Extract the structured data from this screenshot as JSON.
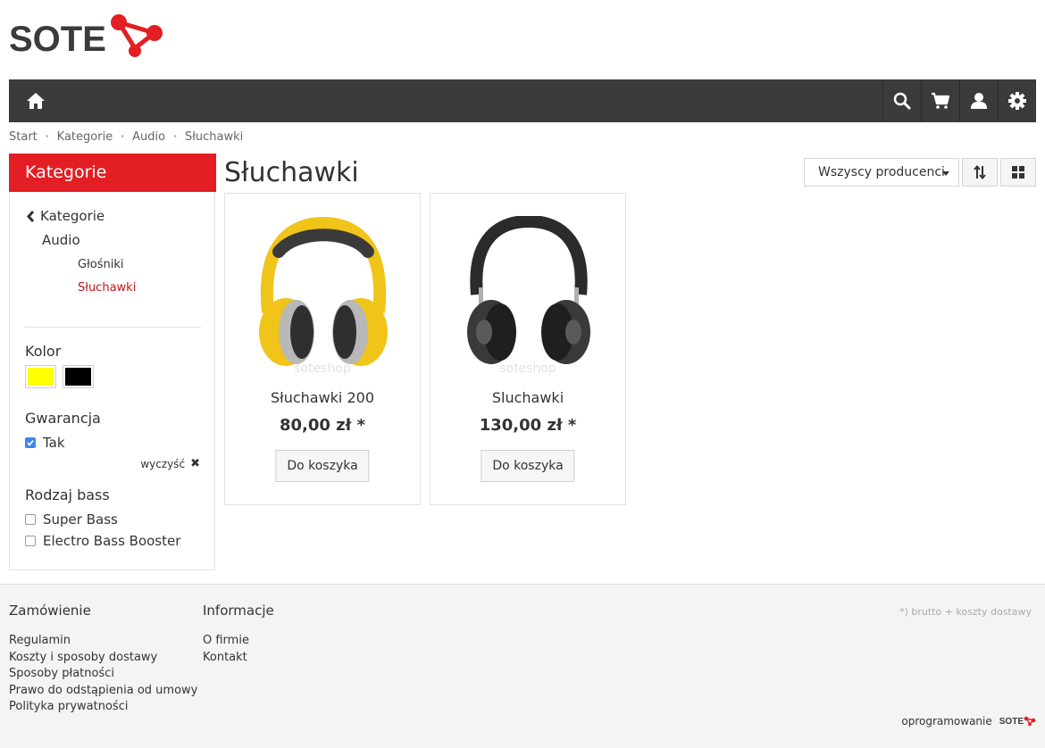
{
  "brand": {
    "logo_text": "SOTE",
    "accent": "#e31e24",
    "dark": "#3b3b3b"
  },
  "nav": {
    "home_icon": "home-icon",
    "right_icons": [
      "search-icon",
      "cart-icon",
      "user-icon",
      "gear-icon"
    ]
  },
  "breadcrumb": [
    "Start",
    "Kategorie",
    "Audio",
    "Słuchawki"
  ],
  "sidebar": {
    "heading": "Kategorie",
    "back_label": "Kategorie",
    "parent_label": "Audio",
    "children": [
      {
        "label": "Głośniki",
        "active": false
      },
      {
        "label": "Słuchawki",
        "active": true
      }
    ],
    "filters": {
      "color_title": "Kolor",
      "colors": [
        "#ffff00",
        "#000000"
      ],
      "warranty_title": "Gwarancja",
      "warranty_option": "Tak",
      "warranty_checked": true,
      "clear_label": "wyczyść",
      "bass_title": "Rodzaj bass",
      "bass_options": [
        "Super Bass",
        "Electro Bass Booster"
      ]
    }
  },
  "main": {
    "title": "Słuchawki",
    "producer_select": "Wszyscy producenci",
    "products": [
      {
        "name": "Słuchawki 200",
        "price": "80,00 zł *",
        "button": "Do koszyka",
        "watermark": "soteshop",
        "color": "yellow"
      },
      {
        "name": "Sluchawki",
        "price": "130,00 zł *",
        "button": "Do koszyka",
        "watermark": "soteshop",
        "color": "black"
      }
    ]
  },
  "footer": {
    "col1_title": "Zamówienie",
    "col1_links": [
      "Regulamin",
      "Koszty i sposoby dostawy",
      "Sposoby płatności",
      "Prawo do odstąpienia od umowy",
      "Polityka prywatności"
    ],
    "col2_title": "Informacje",
    "col2_links": [
      "O firmie",
      "Kontakt"
    ],
    "note": "*) brutto + koszty dostawy",
    "powered_by": "oprogramowanie",
    "powered_logo": "SOTE"
  }
}
